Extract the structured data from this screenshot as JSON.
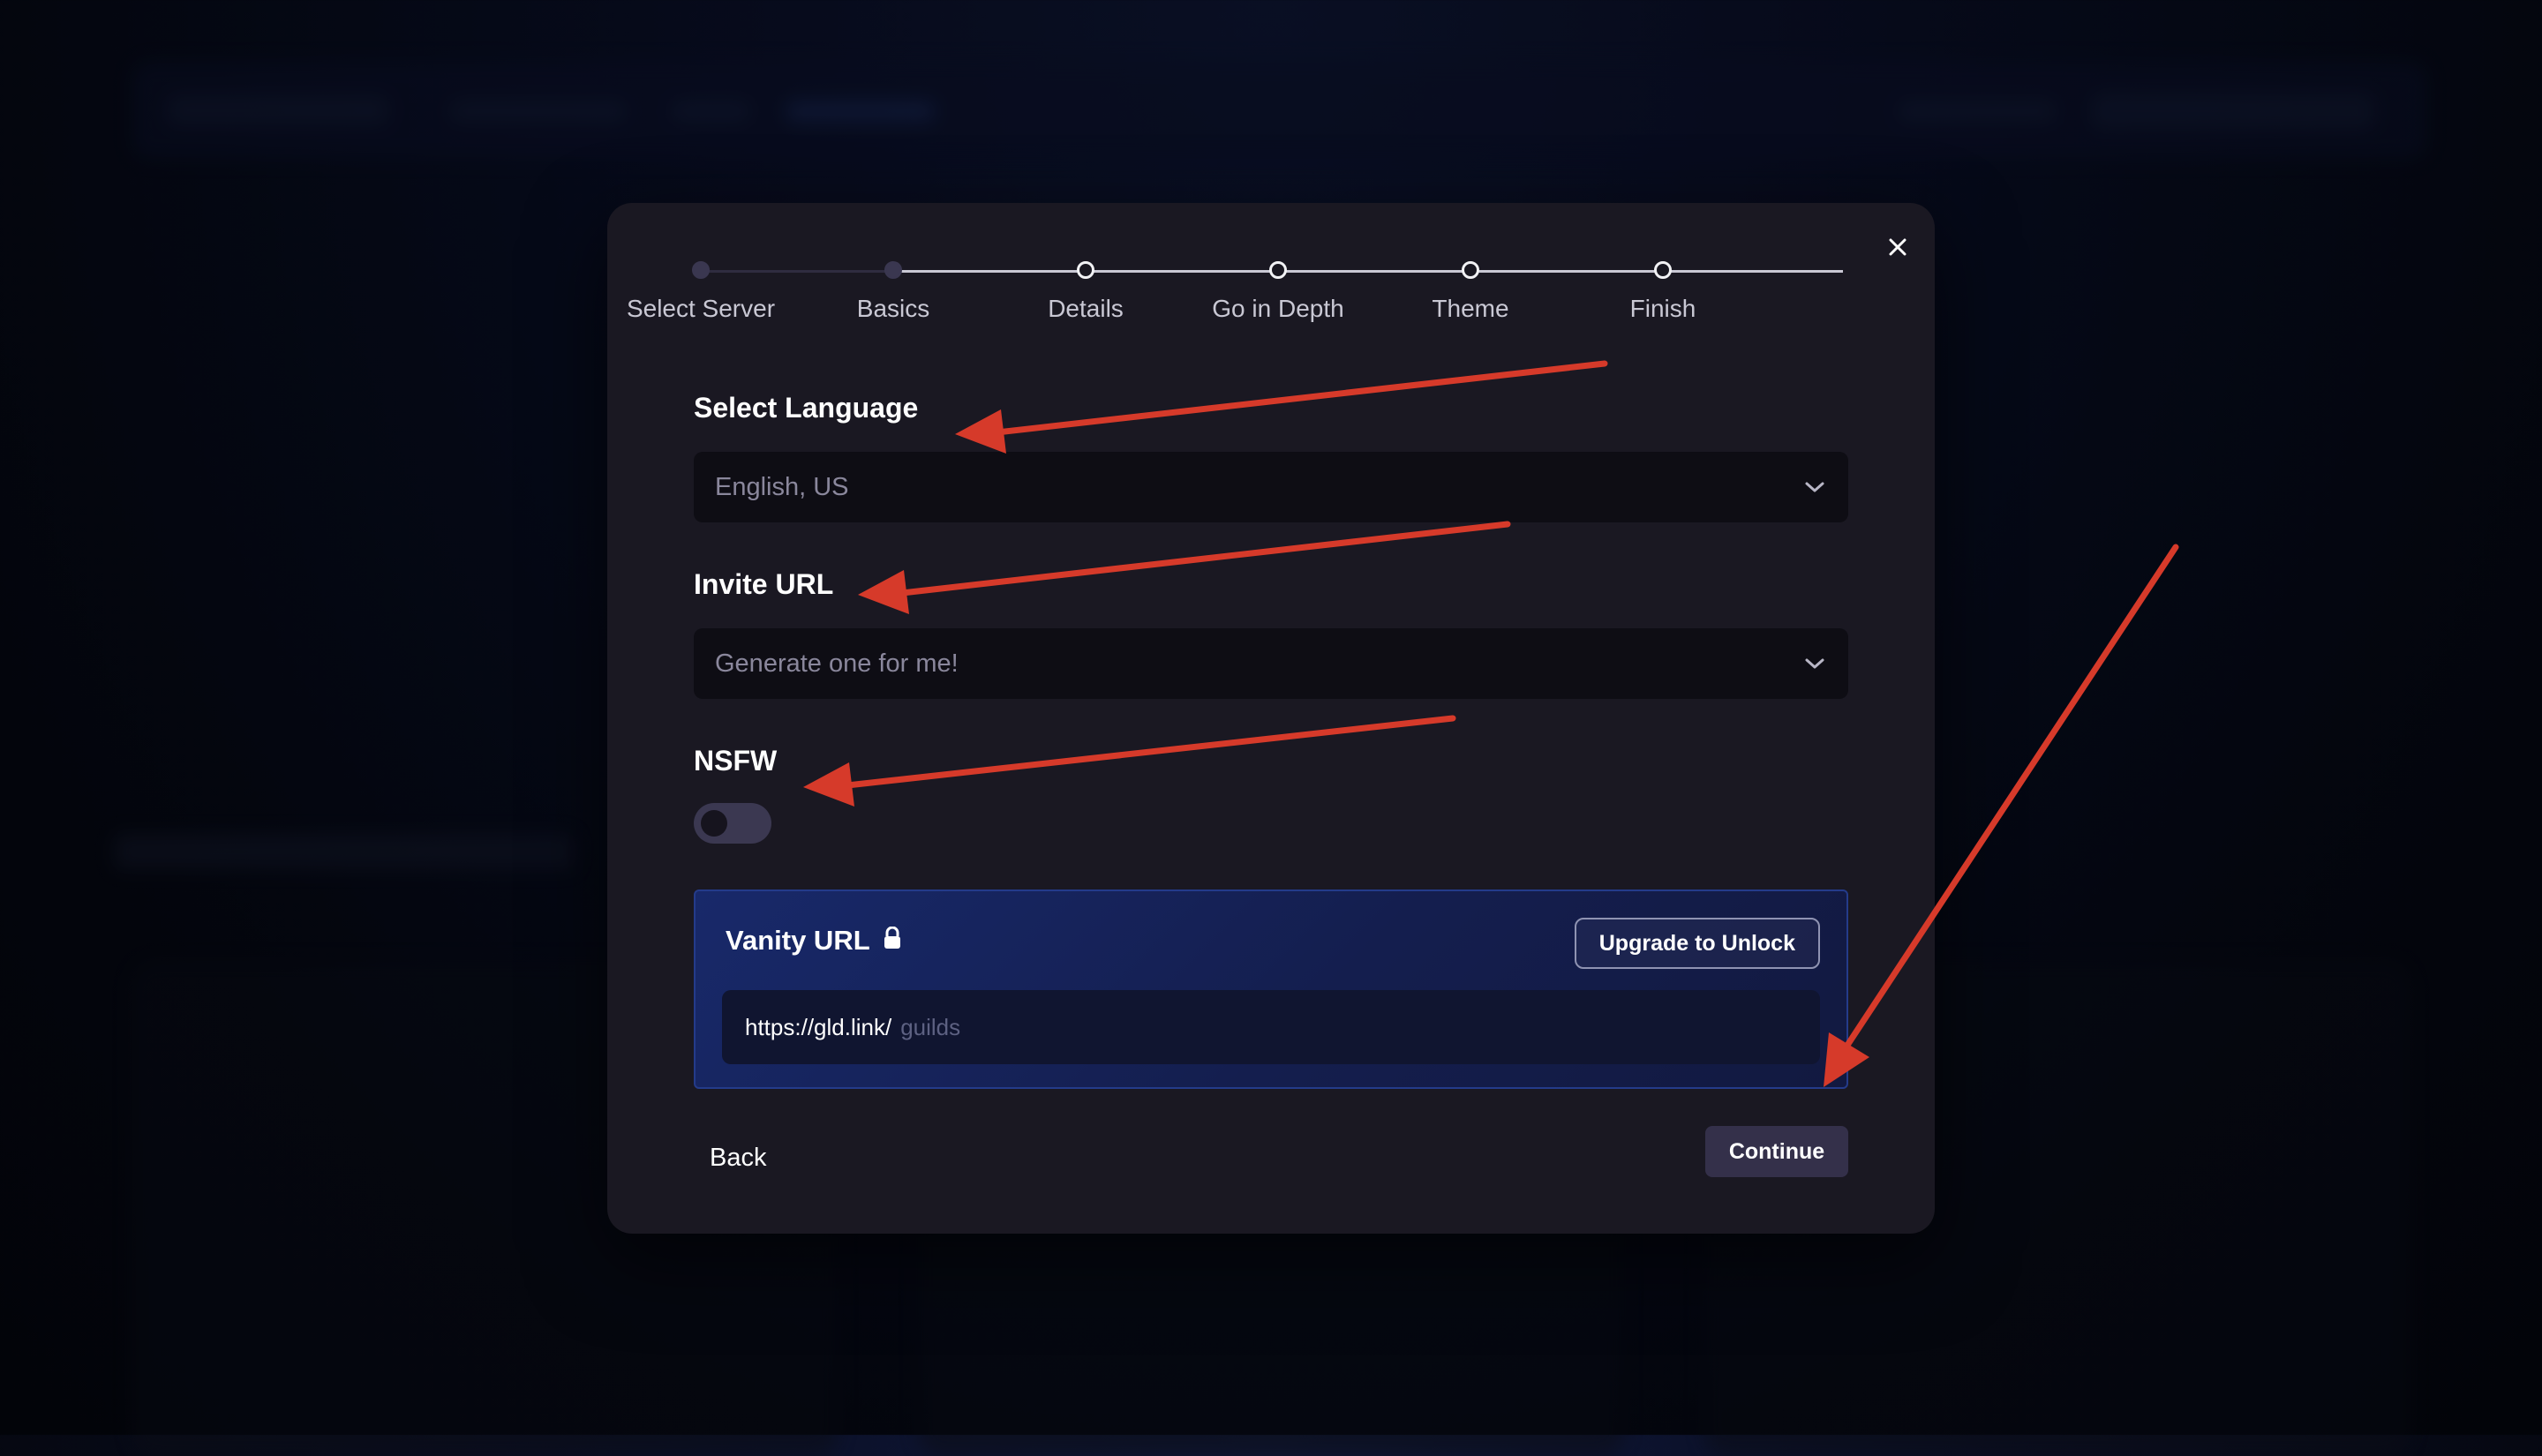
{
  "stepper": {
    "steps": [
      {
        "label": "Select Server",
        "state": "done"
      },
      {
        "label": "Basics",
        "state": "done"
      },
      {
        "label": "Details",
        "state": "todo"
      },
      {
        "label": "Go in Depth",
        "state": "todo"
      },
      {
        "label": "Theme",
        "state": "todo"
      },
      {
        "label": "Finish",
        "state": "todo"
      }
    ]
  },
  "form": {
    "language": {
      "label": "Select Language",
      "value": "English, US"
    },
    "invite": {
      "label": "Invite URL",
      "value": "Generate one for me!"
    },
    "nsfw": {
      "label": "NSFW",
      "enabled": false
    }
  },
  "vanity": {
    "title": "Vanity URL",
    "upgrade_label": "Upgrade to Unlock",
    "prefix": "https://gld.link/",
    "placeholder": "guilds"
  },
  "footer": {
    "back_label": "Back",
    "continue_label": "Continue"
  },
  "colors": {
    "modal_bg": "#1a1822",
    "accent_arrow": "#d63a2a",
    "vanity_bg": "#18296a"
  },
  "icons": {
    "close": "close-icon",
    "select": "chevron-down-icon",
    "vanity": "lock-icon"
  }
}
